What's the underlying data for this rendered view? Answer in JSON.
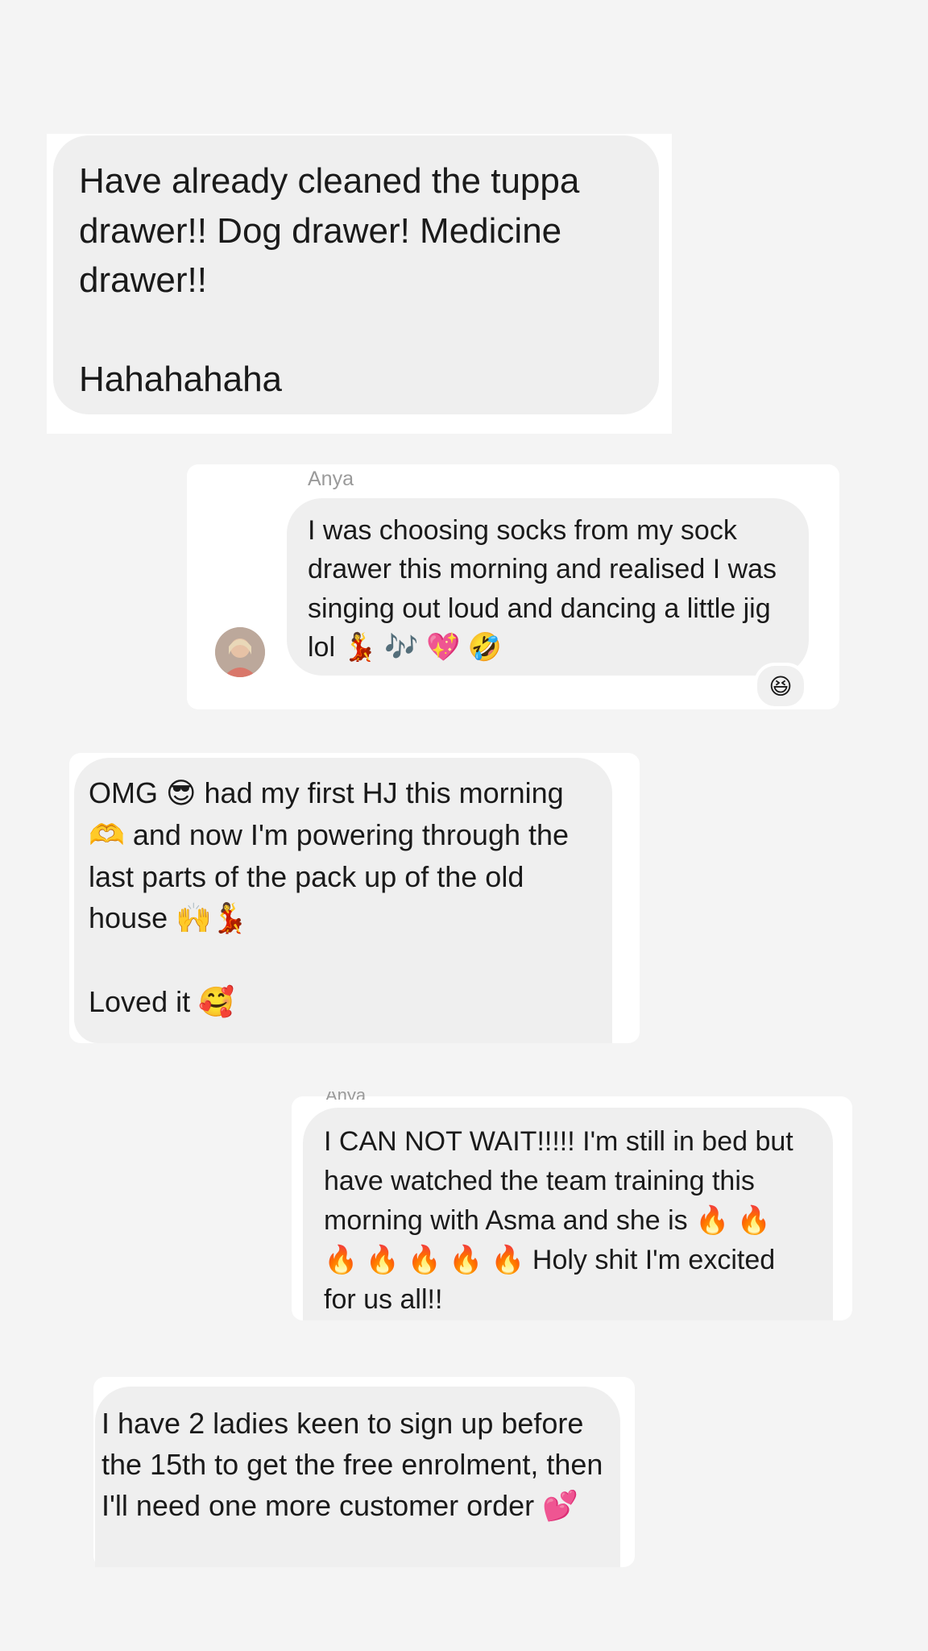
{
  "messages": [
    {
      "id": "m1",
      "direction": "outgoing",
      "text": "Have already cleaned the tuppa drawer!! Dog drawer! Medicine drawer!!\n\nHahahahaha"
    },
    {
      "id": "m2",
      "direction": "incoming",
      "sender": "Anya",
      "text": "I was choosing socks from my sock drawer this morning and realised I was singing out loud and dancing a little jig lol 💃 🎶 💖 🤣",
      "reaction": "😆"
    },
    {
      "id": "m3",
      "direction": "outgoing",
      "text": "OMG 😎 had my first HJ this morning 🫶 and now I'm powering through the last parts of the pack up of the old house 🙌💃\n\nLoved it 🥰"
    },
    {
      "id": "m4",
      "direction": "incoming",
      "sender": "Anya",
      "text": "I CAN NOT WAIT!!!!! I'm still in bed but have watched the team training this morning with Asma and she is 🔥 🔥 🔥 🔥 🔥 🔥 🔥 Holy shit I'm excited for us all!!"
    },
    {
      "id": "m5",
      "direction": "outgoing",
      "text": "I have 2 ladies keen to sign up before the 15th to get the free enrolment, then I'll need one more customer order 💕"
    }
  ],
  "colors": {
    "background": "#f4f4f4",
    "card": "#ffffff",
    "bubble": "#efefef",
    "text": "#1a1a1a",
    "sender": "#9a9a9a"
  }
}
